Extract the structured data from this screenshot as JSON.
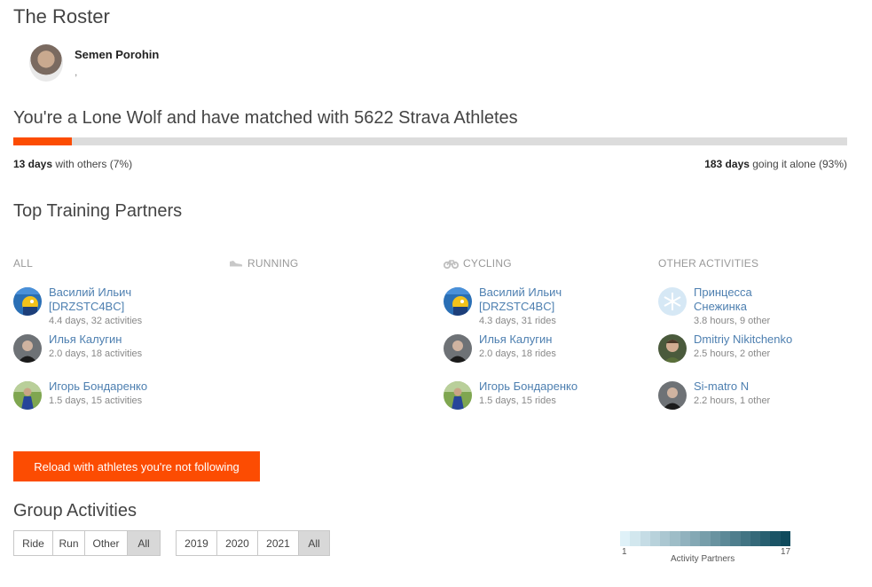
{
  "page": {
    "title": "The Roster"
  },
  "athlete": {
    "name": "Semen Porohin",
    "location": ","
  },
  "summary": {
    "headline": "You're a Lone Wolf and have matched with 5622 Strava Athletes",
    "percent_with_others": 7,
    "with_others_days": "13 days",
    "with_others_text": " with others (7%)",
    "alone_days": "183 days",
    "alone_text": " going it alone (93%)",
    "accent_color": "#fc4c02"
  },
  "partners_section": {
    "title": "Top Training Partners"
  },
  "columns": {
    "all": {
      "label": "ALL",
      "partners": [
        {
          "name": "Василий Ильич [DRZSTC4BC]",
          "meta": "4.4 days, 32 activities",
          "avatar": "avatar-yellow-cartoon-icon"
        },
        {
          "name": "Илья Калугин",
          "meta": "2.0 days, 18 activities",
          "avatar": "avatar-dark-photo-icon"
        },
        {
          "name": "Игорь Бондаренко",
          "meta": "1.5 days, 15 activities",
          "avatar": "avatar-outdoor-photo-icon"
        }
      ]
    },
    "running": {
      "label": "RUNNING",
      "icon": "shoe-icon",
      "partners": []
    },
    "cycling": {
      "label": "CYCLING",
      "icon": "bike-icon",
      "partners": [
        {
          "name": "Василий Ильич [DRZSTC4BC]",
          "meta": "4.3 days, 31 rides",
          "avatar": "avatar-yellow-cartoon-icon"
        },
        {
          "name": "Илья Калугин",
          "meta": "2.0 days, 18 rides",
          "avatar": "avatar-dark-photo-icon"
        },
        {
          "name": "Игорь Бондаренко",
          "meta": "1.5 days, 15 rides",
          "avatar": "avatar-outdoor-photo-icon"
        }
      ]
    },
    "other": {
      "label": "OTHER ACTIVITIES",
      "partners": [
        {
          "name": "Принцесса Снежинка",
          "meta": "3.8 hours, 9 other",
          "avatar": "avatar-snowflake-icon"
        },
        {
          "name": "Dmitriy Nikitchenko",
          "meta": "2.5 hours, 2 other",
          "avatar": "avatar-portrait-photo-icon"
        },
        {
          "name": "Si-matro N",
          "meta": "2.2 hours, 1 other",
          "avatar": "avatar-dark-photo-icon"
        }
      ]
    }
  },
  "reload_button": {
    "label": "Reload with athletes you're not following"
  },
  "group_section": {
    "title": "Group Activities"
  },
  "activity_filter": [
    "Ride",
    "Run",
    "Other",
    "All"
  ],
  "activity_filter_selected": "All",
  "year_filter": [
    "2019",
    "2020",
    "2021",
    "All"
  ],
  "year_filter_selected": "All",
  "legend": {
    "min": "1",
    "max": "17",
    "label": "Activity Partners",
    "color_low": "#dff1f8",
    "color_high": "#0e4a5c"
  }
}
